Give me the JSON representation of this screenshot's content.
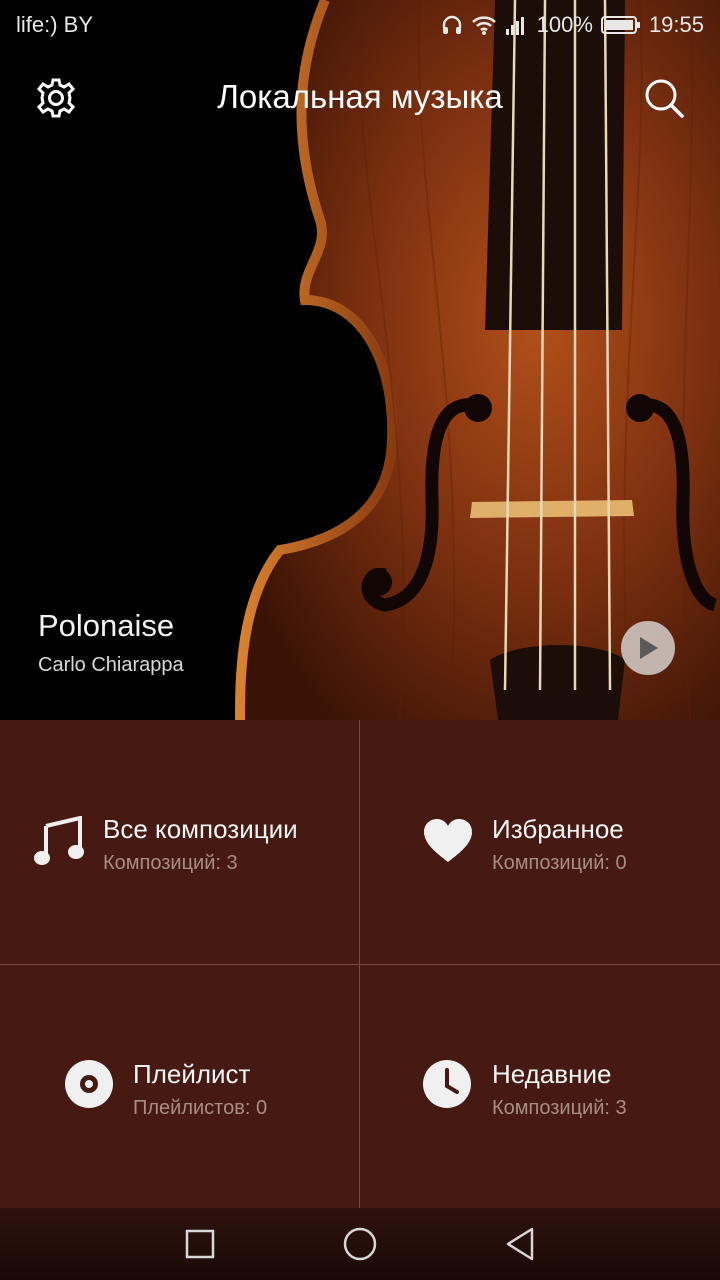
{
  "status": {
    "carrier": "life:) BY",
    "battery": "100%",
    "time": "19:55"
  },
  "header": {
    "title": "Локальная музыка"
  },
  "now_playing": {
    "title": "Polonaise",
    "artist": "Carlo Chiarappa"
  },
  "tiles": [
    {
      "label": "Все композиции",
      "sub": "Композиций: 3",
      "icon": "music-note-icon"
    },
    {
      "label": "Избранное",
      "sub": "Композиций: 0",
      "icon": "heart-icon"
    },
    {
      "label": "Плейлист",
      "sub": "Плейлистов: 0",
      "icon": "disc-icon"
    },
    {
      "label": "Недавние",
      "sub": "Композиций: 3",
      "icon": "clock-icon"
    }
  ],
  "colors": {
    "grid_bg": "#461a12",
    "divider": "#7a4a40",
    "subtext": "#a88c86"
  }
}
